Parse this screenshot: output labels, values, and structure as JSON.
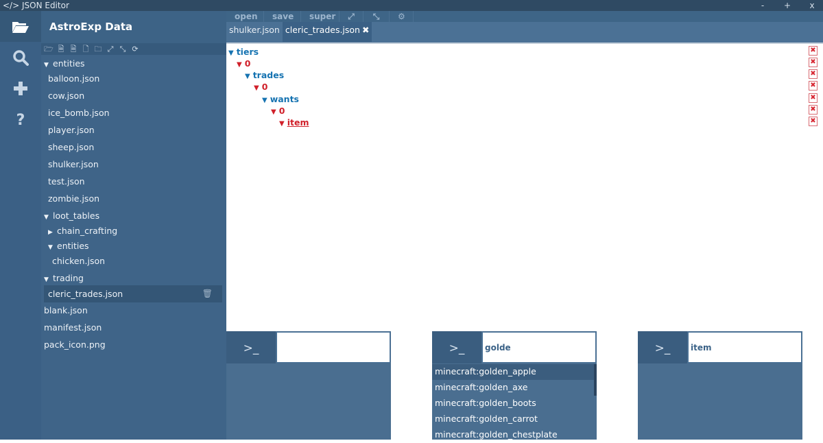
{
  "window": {
    "title": "</> JSON Editor",
    "minimize": "-",
    "maximize": "+",
    "close": "x"
  },
  "iconbar": [
    {
      "name": "folder-open-icon",
      "glyph": "📂"
    },
    {
      "name": "search-icon",
      "glyph": "🔍"
    },
    {
      "name": "plus-icon",
      "glyph": "+"
    },
    {
      "name": "help-icon",
      "glyph": "?"
    }
  ],
  "sidebar": {
    "title": "AstroExp Data",
    "toolbar": [
      {
        "name": "open-folder-icon",
        "glyph": "🗁"
      },
      {
        "name": "new-json-file-icon",
        "glyph": "🗎"
      },
      {
        "name": "new-code-file-icon",
        "glyph": "🗎"
      },
      {
        "name": "new-file-icon",
        "glyph": "🗋"
      },
      {
        "name": "new-folder-icon",
        "glyph": "🗀"
      },
      {
        "name": "expand-all-icon",
        "glyph": "⤢"
      },
      {
        "name": "collapse-all-icon",
        "glyph": "⤡"
      },
      {
        "name": "refresh-icon",
        "glyph": "⟳"
      }
    ],
    "tree": [
      {
        "label": "entities",
        "caret": "▼",
        "level": 0,
        "type": "folder"
      },
      {
        "label": "balloon.json",
        "level": 1,
        "type": "file"
      },
      {
        "label": "cow.json",
        "level": 1,
        "type": "file"
      },
      {
        "label": "ice_bomb.json",
        "level": 1,
        "type": "file"
      },
      {
        "label": "player.json",
        "level": 1,
        "type": "file"
      },
      {
        "label": "sheep.json",
        "level": 1,
        "type": "file"
      },
      {
        "label": "shulker.json",
        "level": 1,
        "type": "file"
      },
      {
        "label": "test.json",
        "level": 1,
        "type": "file"
      },
      {
        "label": "zombie.json",
        "level": 1,
        "type": "file"
      },
      {
        "label": "loot_tables",
        "caret": "▼",
        "level": 0,
        "type": "folder"
      },
      {
        "label": "chain_crafting",
        "caret": "▶",
        "level": 1,
        "type": "folder"
      },
      {
        "label": "entities",
        "caret": "▼",
        "level": 1,
        "type": "folder"
      },
      {
        "label": "chicken.json",
        "level": 2,
        "type": "file"
      },
      {
        "label": "trading",
        "caret": "▼",
        "level": 0,
        "type": "folder"
      },
      {
        "label": "cleric_trades.json",
        "level": 1,
        "type": "file",
        "selected": true
      },
      {
        "label": "blank.json",
        "level": 0,
        "type": "file"
      },
      {
        "label": "manifest.json",
        "level": 0,
        "type": "file"
      },
      {
        "label": "pack_icon.png",
        "level": 0,
        "type": "file"
      }
    ],
    "trash_icon": "🗑"
  },
  "menubar": [
    {
      "label": "open"
    },
    {
      "label": "save"
    },
    {
      "label": "super"
    },
    {
      "label": "⤢",
      "name": "expand-icon"
    },
    {
      "label": "⤡",
      "name": "collapse-icon"
    },
    {
      "label": "⚙",
      "name": "gear-icon"
    }
  ],
  "tabs": [
    {
      "label": "shulker.json",
      "active": false
    },
    {
      "label": "cleric_trades.json",
      "active": true,
      "close": "✖"
    }
  ],
  "editor": {
    "nodes": [
      {
        "label": "tiers",
        "color": "blue",
        "level": 0
      },
      {
        "label": "0",
        "color": "red",
        "level": 1
      },
      {
        "label": "trades",
        "color": "blue",
        "level": 2
      },
      {
        "label": "0",
        "color": "red",
        "level": 3
      },
      {
        "label": "wants",
        "color": "blue",
        "level": 4
      },
      {
        "label": "0",
        "color": "red",
        "level": 5
      },
      {
        "label": "item",
        "color": "red",
        "level": 6,
        "underline": true
      }
    ],
    "caret": "▼",
    "delete_glyph": "✖"
  },
  "consoles": [
    {
      "prompt": ">_",
      "value": "",
      "suggestions": []
    },
    {
      "prompt": ">_",
      "value": "golde",
      "suggestions": [
        "minecraft:golden_apple",
        "minecraft:golden_axe",
        "minecraft:golden_boots",
        "minecraft:golden_carrot",
        "minecraft:golden_chestplate"
      ]
    },
    {
      "prompt": ">_",
      "value": "item",
      "suggestions": []
    }
  ],
  "colors": {
    "key_blue": "#1673b1",
    "index_red": "#d0202a",
    "panel": "#3f6488",
    "titlebar": "#2f4a63"
  }
}
